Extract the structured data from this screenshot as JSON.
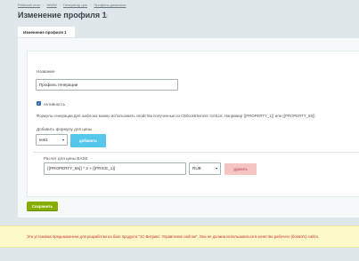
{
  "breadcrumb": [
    "Рабочий стол",
    "WWW",
    "Генератор цен",
    "Профиль демоаххх"
  ],
  "page": {
    "title": "Изменение профиля 1"
  },
  "tabs": [
    {
      "label": "Изменение профиля 1"
    }
  ],
  "form": {
    "name_label": "Название",
    "name_value": "Профиль генерации",
    "active_label": "Активность",
    "active_checked": true,
    "formula_hint": "Формулы генерации Для шаблона можно использовать свойства полученные из CIBlockElement::GetList. Например {{PROPERTY_1}} или {{PROPERTY_65}}",
    "add_formula_label": "Добавить формулу для цены",
    "price_type_value": "test1",
    "add_button": "добавить",
    "base_section_label": "Расчет для цены BASE",
    "formula_value": "{{PROPERTY_65}} * 2 + {{PRICE_1}}",
    "currency_value": "RUB",
    "delete_button": "удалить",
    "save_button": "Сохранить"
  },
  "warning": {
    "text": "Эта установка предназначена для разработки на базе продукта \"1С-Битрикс: Управление сайтом\". Она не должна использоваться в качестве рабочего (боевого) сайта."
  },
  "colors": {
    "accent_blue": "#55c7ec",
    "save_green": "#86ad00",
    "delete_red": "#f5c5c6",
    "warning_bg": "#fef9c8"
  }
}
